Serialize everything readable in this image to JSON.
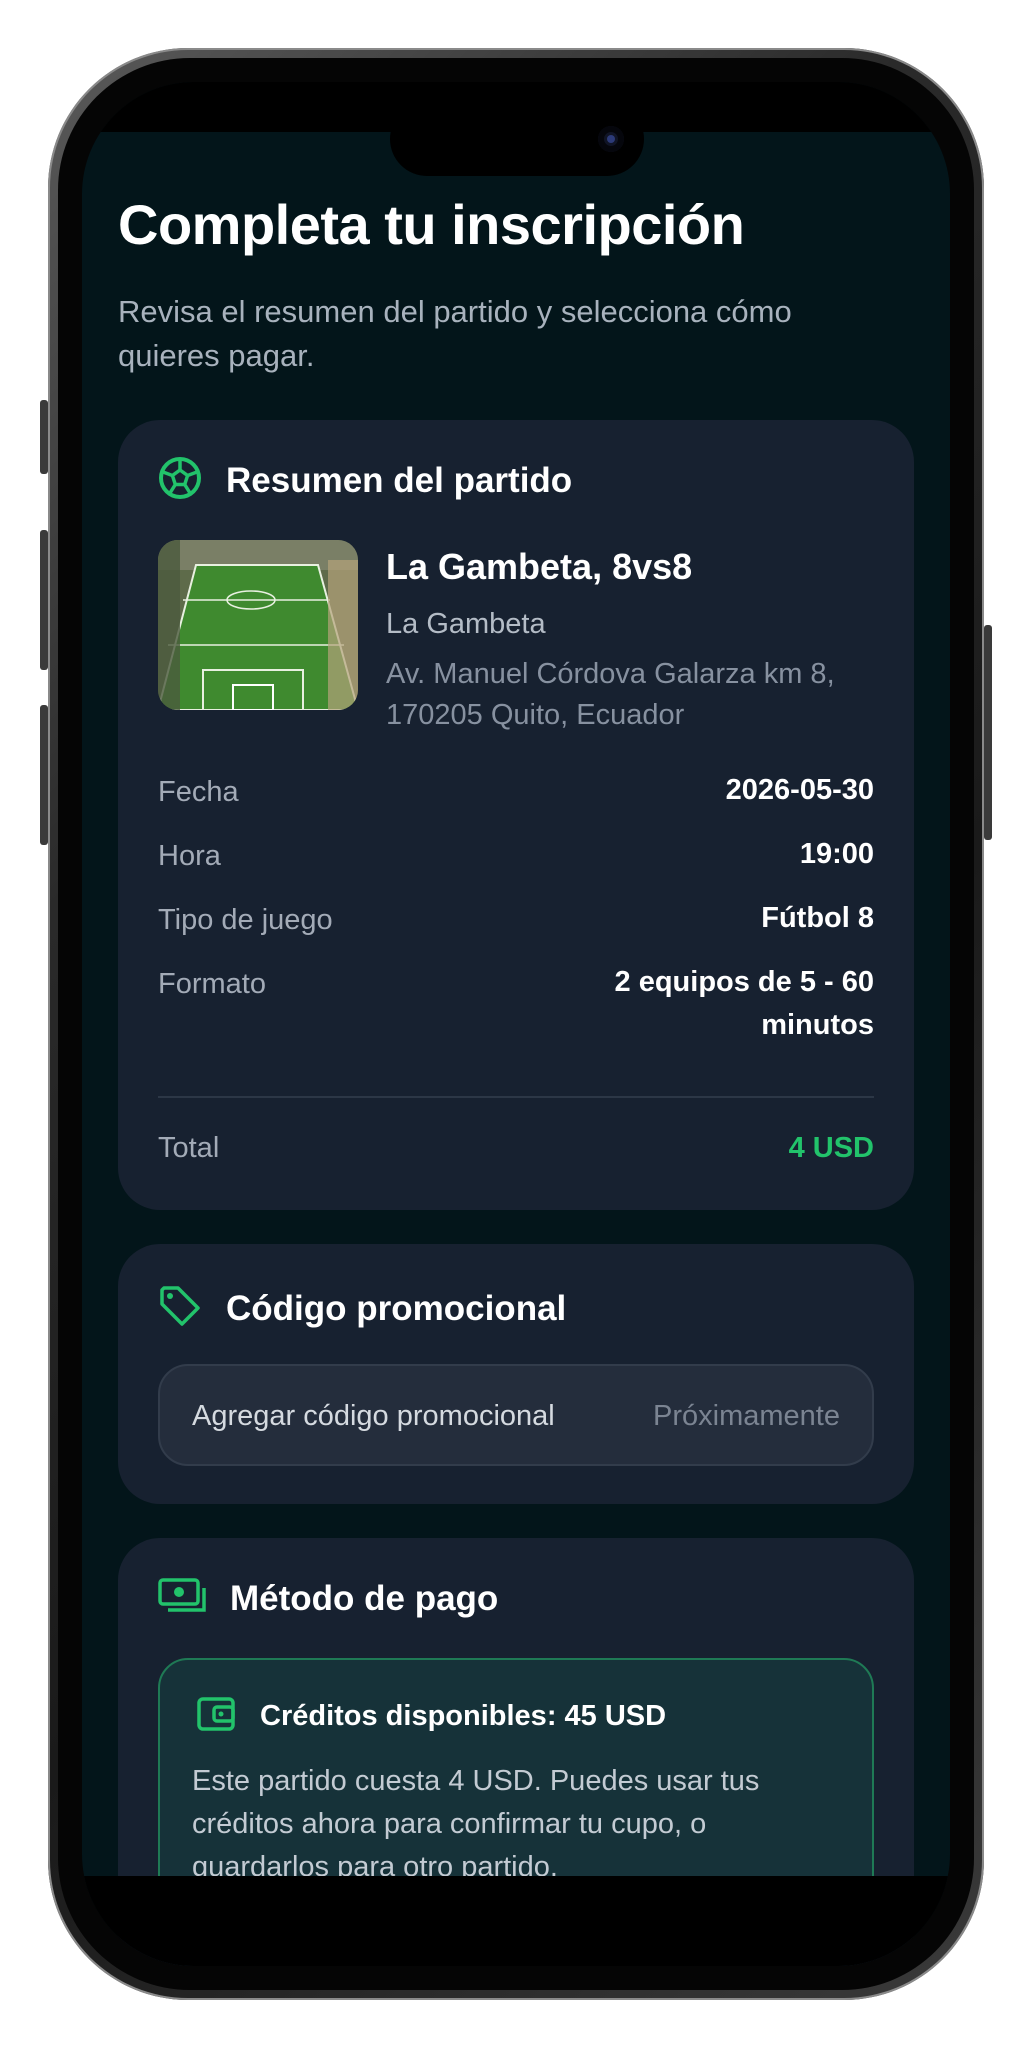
{
  "header": {
    "title": "Completa tu inscripción",
    "subtitle": "Revisa el resumen del partido y selecciona cómo quieres pagar."
  },
  "summary": {
    "heading": "Resumen del partido",
    "icon": "soccer-ball-icon",
    "match_name": "La Gambeta, 8vs8",
    "venue": "La Gambeta",
    "address": "Av. Manuel Córdova Galarza km 8, 170205 Quito, Ecuador",
    "details": [
      {
        "label": "Fecha",
        "value": "2026-05-30"
      },
      {
        "label": "Hora",
        "value": "19:00"
      },
      {
        "label": "Tipo de juego",
        "value": "Fútbol 8"
      },
      {
        "label": "Formato",
        "value": "2 equipos de 5 - 60 minutos"
      }
    ],
    "total_label": "Total",
    "total_value": "4 USD"
  },
  "promo": {
    "heading": "Código promocional",
    "icon": "tag-icon",
    "field_label": "Agregar código promocional",
    "status": "Próximamente"
  },
  "payment": {
    "heading": "Método de pago",
    "icon": "cash-icon",
    "credits_title": "Créditos disponibles: 45 USD",
    "credits_icon": "wallet-icon",
    "credits_description": "Este partido cuesta 4 USD. Puedes usar tus créditos ahora para confirmar tu cupo, o guardarlos para otro partido."
  },
  "colors": {
    "accent": "#22c36b",
    "background": "#03151a",
    "card": "#172130"
  }
}
